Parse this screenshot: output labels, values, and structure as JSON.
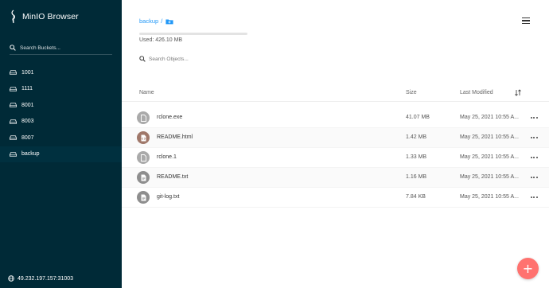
{
  "app": {
    "title": "MinIO Browser",
    "logo_icon": "minio-logo-icon"
  },
  "sidebar": {
    "search_placeholder": "Search Buckets...",
    "buckets": [
      {
        "label": "1001",
        "active": false
      },
      {
        "label": "1111",
        "active": false
      },
      {
        "label": "8001",
        "active": false
      },
      {
        "label": "8003",
        "active": false
      },
      {
        "label": "8007",
        "active": false
      },
      {
        "label": "backup",
        "active": true
      }
    ],
    "host": "49.232.197.157:31003",
    "background_color": "#002a37"
  },
  "header": {
    "bucket_name": "backup",
    "separator": "/",
    "usage_text": "Used: 426.10 MB",
    "search_placeholder": "Search Objects..."
  },
  "table": {
    "columns": {
      "name": "Name",
      "size": "Size",
      "modified": "Last Modified"
    },
    "rows": [
      {
        "name": "rclone.exe",
        "size": "41.07 MB",
        "modified": "May 25, 2021 10:55 A...",
        "icon_color": "#aaaaaa",
        "icon": "file-icon"
      },
      {
        "name": "README.html",
        "size": "1.42 MB",
        "modified": "May 25, 2021 10:55 A...",
        "icon_color": "#a0786a",
        "icon": "file-code-icon"
      },
      {
        "name": "rclone.1",
        "size": "1.33 MB",
        "modified": "May 25, 2021 10:55 A...",
        "icon_color": "#aaaaaa",
        "icon": "file-icon"
      },
      {
        "name": "README.txt",
        "size": "1.16 MB",
        "modified": "May 25, 2021 10:55 A...",
        "icon_color": "#8e8e8e",
        "icon": "file-text-icon"
      },
      {
        "name": "git-log.txt",
        "size": "7.84 KB",
        "modified": "May 25, 2021 10:55 A...",
        "icon_color": "#8e8e8e",
        "icon": "file-text-icon"
      }
    ]
  },
  "fab": {
    "label": "+",
    "color": "#ff726f"
  },
  "accent_color": "#2298f7"
}
